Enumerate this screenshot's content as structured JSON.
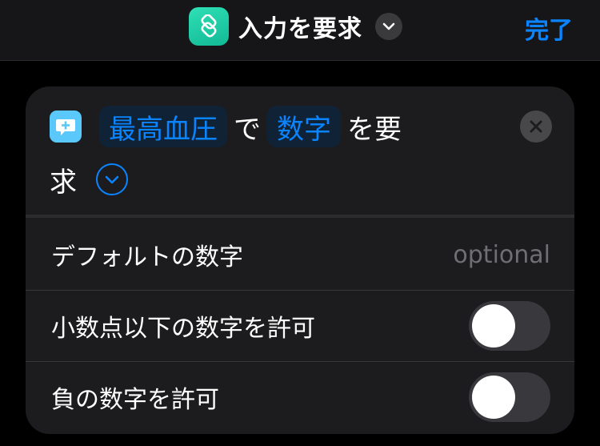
{
  "topbar": {
    "title": "入力を要求",
    "done_label": "完了",
    "app_icon": "shortcuts-icon",
    "chevron_icon": "chevron-down-icon"
  },
  "action": {
    "icon": "message-plus-icon",
    "variable": "最高血圧",
    "connector": "で",
    "type_token": "数字",
    "suffix_line1": "を要",
    "suffix_line2": "求"
  },
  "rows": [
    {
      "label": "デフォルトの数字",
      "value": "optional"
    },
    {
      "label": "小数点以下の数字を許可",
      "toggle": false
    },
    {
      "label": "負の数字を許可",
      "toggle": false
    }
  ],
  "colors": {
    "accent": "#0a84ff",
    "background": "#000000",
    "card": "#1c1c1e",
    "app_icon": "#2fe0b6",
    "action_icon": "#5ac8fa"
  }
}
